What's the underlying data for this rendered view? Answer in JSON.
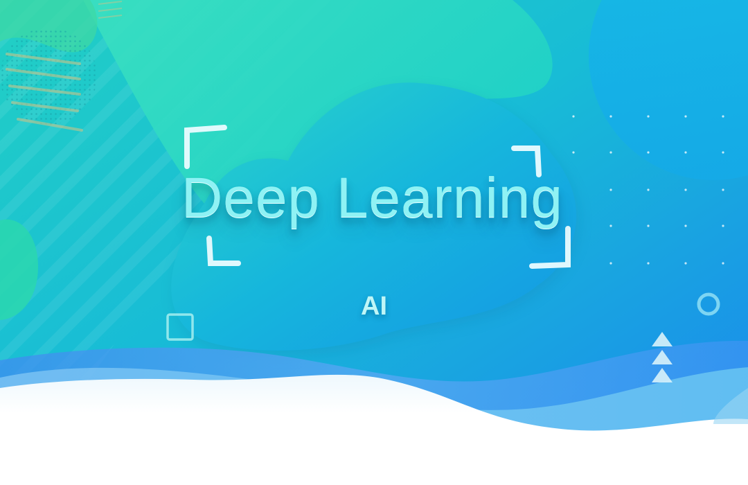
{
  "banner": {
    "headline": "Deep Learning",
    "subtitle": "AI"
  },
  "colors": {
    "teal": "#1fd6b6",
    "cyan": "#18b8d8",
    "blue": "#1a8cf0",
    "light_blue": "#7fd3f5",
    "white": "#ffffff"
  },
  "decorations": [
    "corner-bracket-icon",
    "square-outline-icon",
    "ring-icon",
    "triangle-stack-icon",
    "dot-grid",
    "halftone-pattern",
    "stripe-pattern"
  ]
}
